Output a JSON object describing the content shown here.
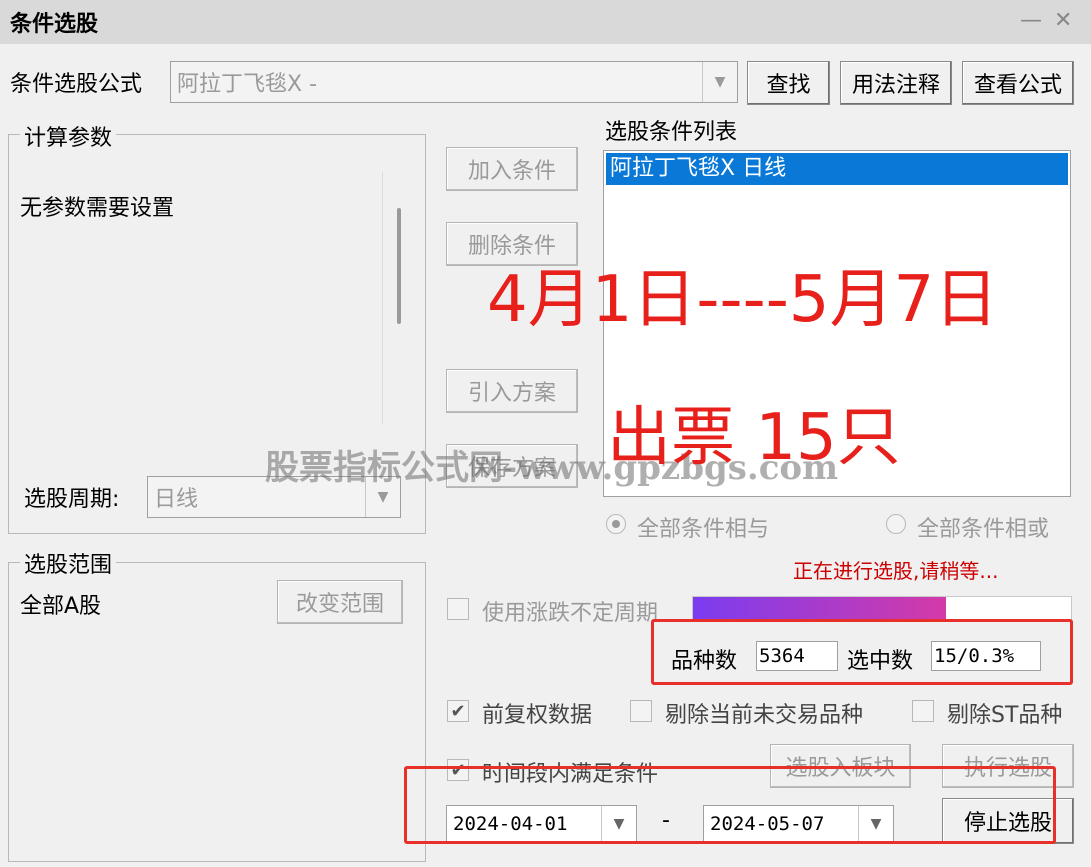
{
  "window": {
    "title": "条件选股"
  },
  "formula": {
    "label": "条件选股公式",
    "selected": "阿拉丁飞毯X  -",
    "find_button": "查找",
    "usage_button": "用法注释",
    "view_button": "查看公式"
  },
  "params": {
    "group_title": "计算参数",
    "no_params": "无参数需要设置",
    "period_label": "选股周期:",
    "period_value": "日线"
  },
  "actions": {
    "add": "加入条件",
    "delete": "删除条件",
    "import": "引入方案",
    "save": "保存方案"
  },
  "conditions": {
    "title": "选股条件列表",
    "items": [
      "阿拉丁飞毯X  日线"
    ]
  },
  "logic": {
    "and_label": "全部条件相与",
    "or_label": "全部条件相或",
    "selected": "and"
  },
  "scope": {
    "group_title": "选股范围",
    "value": "全部A股",
    "change_button": "改变范围"
  },
  "status": {
    "message": "正在进行选股,请稍等...",
    "progress": 0.67,
    "progress_colors": [
      "#7b3cf0",
      "#d43aa8"
    ]
  },
  "options": {
    "uncertain_period": "使用涨跌不定周期",
    "forward_adjusted": "前复权数据",
    "exclude_untraded": "剔除当前未交易品种",
    "exclude_st": "剔除ST品种",
    "time_range": "时间段内满足条件"
  },
  "stats": {
    "total_label": "品种数",
    "total_value": "5364",
    "selected_label": "选中数",
    "selected_value": "15/0.3%"
  },
  "date_range": {
    "start": "2024-04-01",
    "separator": "-",
    "end": "2024-05-07"
  },
  "buttons": {
    "to_block": "选股入板块",
    "execute": "执行选股",
    "stop": "停止选股"
  },
  "annotations": {
    "date_text": "4月1日----5月7日",
    "result_text": "出票 15只"
  },
  "watermark": "股票指标公式网-www.gpzbgs.com",
  "colors": {
    "annotation_red": "#e8201c",
    "selection_blue": "#0a78d7",
    "status_red": "#cc0000"
  }
}
